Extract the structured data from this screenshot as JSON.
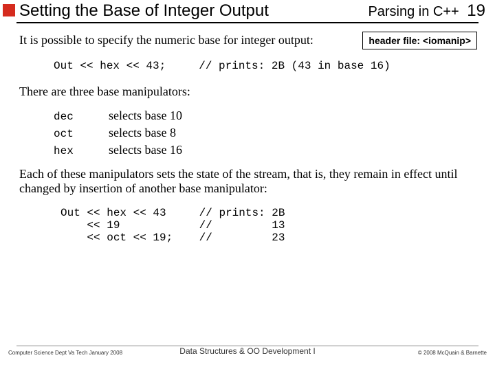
{
  "header": {
    "title": "Setting the Base of Integer Output",
    "course": "Parsing in C++",
    "page": "19"
  },
  "intro": "It is possible to specify the numeric base for integer output:",
  "header_box": "header file: <iomanip>",
  "code1": "Out << hex << 43;     // prints: 2B (43 in base 16)",
  "para2": "There are three base manipulators:",
  "manipulators": [
    {
      "key": "dec",
      "desc": "selects base 10"
    },
    {
      "key": "oct",
      "desc": "selects base 8"
    },
    {
      "key": "hex",
      "desc": "selects base 16"
    }
  ],
  "para3": "Each of these manipulators sets the state of the stream, that is, they remain in effect until changed by insertion of another base manipulator:",
  "code2": "Out << hex << 43     // prints: 2B\n    << 19            //         13\n    << oct << 19;    //         23",
  "footer": {
    "left": "Computer Science Dept Va Tech January 2008",
    "center": "Data Structures & OO Development I",
    "right": "© 2008 McQuain & Barnette"
  }
}
